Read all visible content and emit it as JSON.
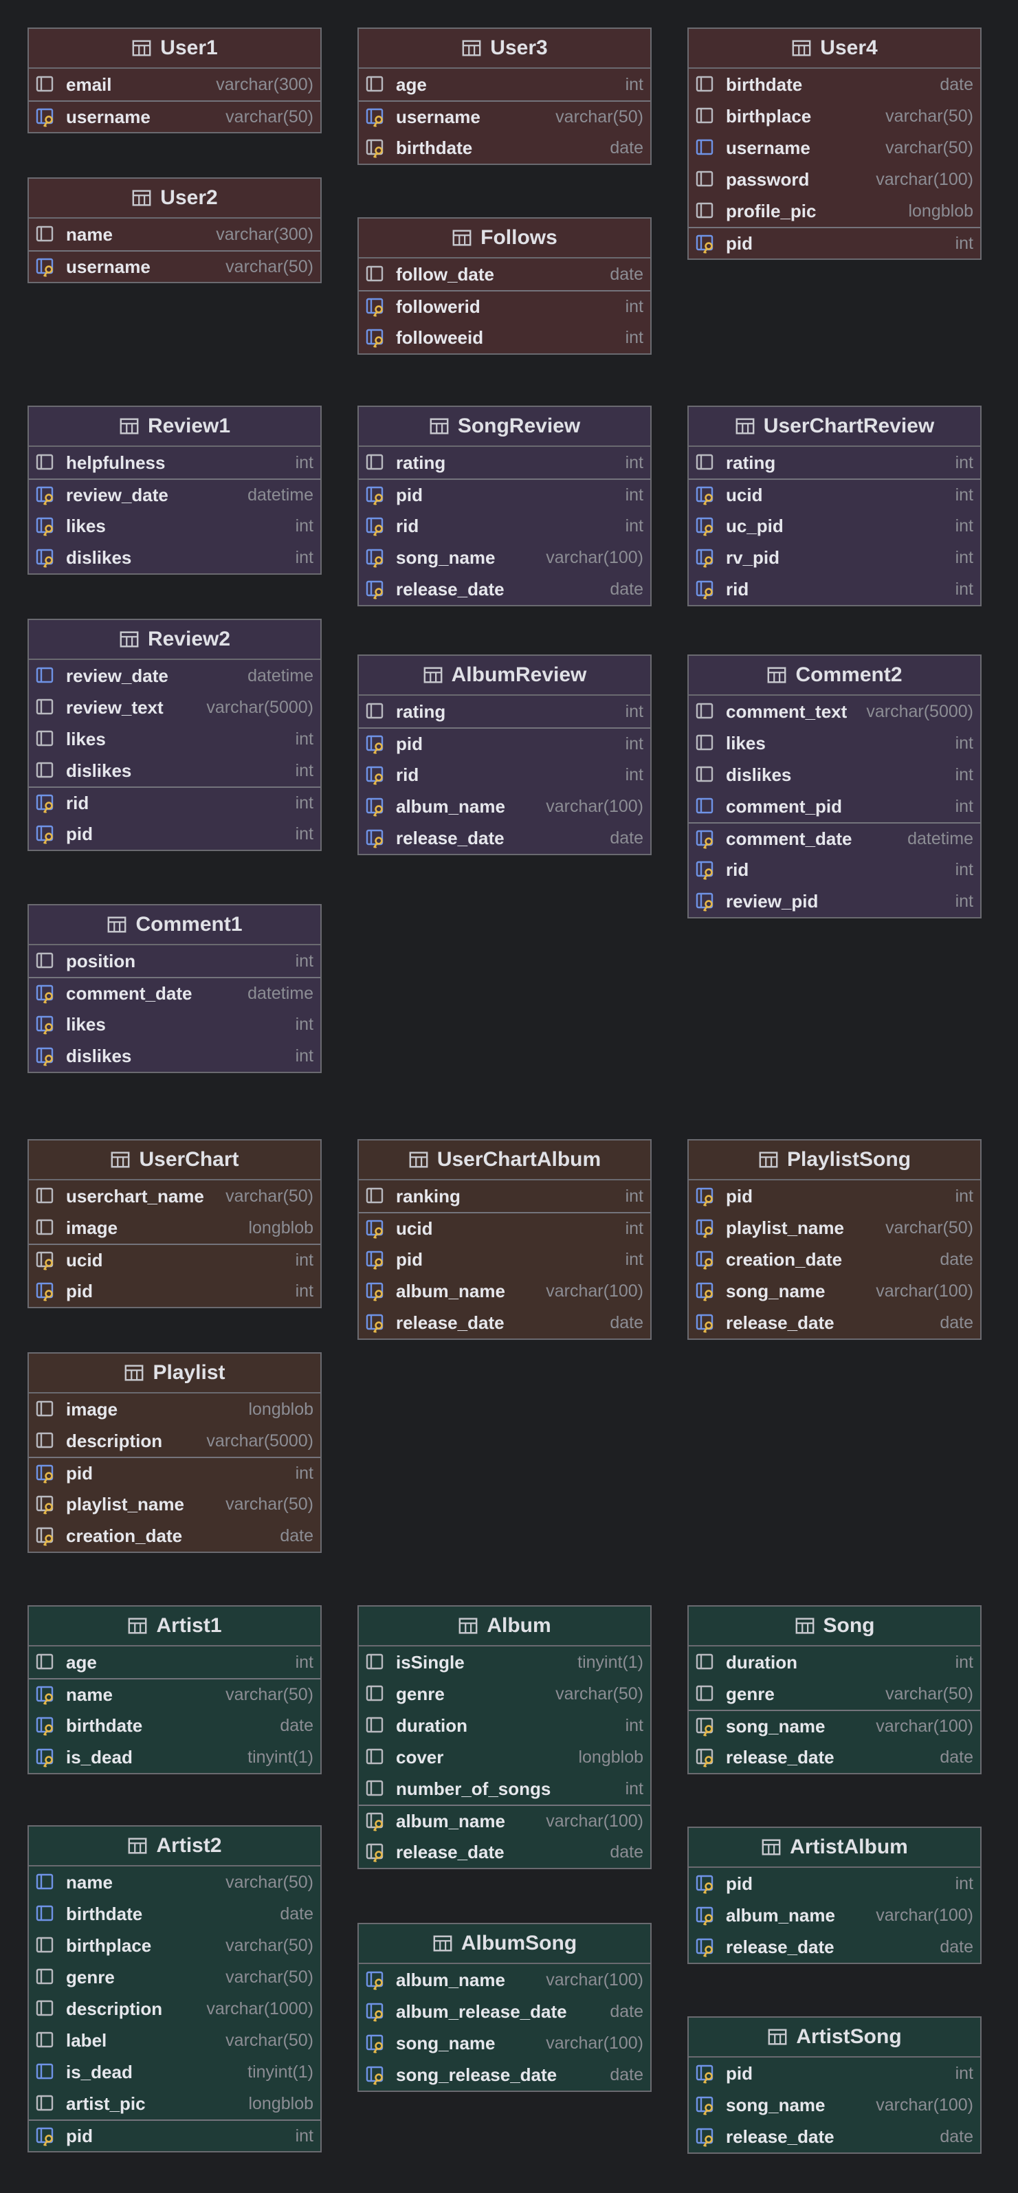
{
  "tables": [
    {
      "name": "User1",
      "group": "user",
      "columns": [
        {
          "name": "email",
          "type": "varchar(300)",
          "icon": "column-icon"
        },
        {
          "name": "username",
          "type": "varchar(50)",
          "icon": "primary-foreign-key-icon",
          "sep": true
        }
      ]
    },
    {
      "name": "User2",
      "group": "user",
      "columns": [
        {
          "name": "name",
          "type": "varchar(300)",
          "icon": "column-icon"
        },
        {
          "name": "username",
          "type": "varchar(50)",
          "icon": "primary-foreign-key-icon",
          "sep": true
        }
      ]
    },
    {
      "name": "User3",
      "group": "user",
      "columns": [
        {
          "name": "age",
          "type": "int",
          "icon": "column-icon"
        },
        {
          "name": "username",
          "type": "varchar(50)",
          "icon": "primary-foreign-key-icon",
          "sep": true
        },
        {
          "name": "birthdate",
          "type": "date",
          "icon": "primary-key-icon"
        }
      ]
    },
    {
      "name": "Follows",
      "group": "user",
      "columns": [
        {
          "name": "follow_date",
          "type": "date",
          "icon": "column-icon"
        },
        {
          "name": "followerid",
          "type": "int",
          "icon": "primary-foreign-key-icon",
          "sep": true
        },
        {
          "name": "followeeid",
          "type": "int",
          "icon": "primary-foreign-key-icon"
        }
      ]
    },
    {
      "name": "User4",
      "group": "user",
      "columns": [
        {
          "name": "birthdate",
          "type": "date",
          "icon": "column-icon"
        },
        {
          "name": "birthplace",
          "type": "varchar(50)",
          "icon": "column-icon"
        },
        {
          "name": "username",
          "type": "varchar(50)",
          "icon": "foreign-key-icon"
        },
        {
          "name": "password",
          "type": "varchar(100)",
          "icon": "column-icon"
        },
        {
          "name": "profile_pic",
          "type": "longblob",
          "icon": "column-icon"
        },
        {
          "name": "pid",
          "type": "int",
          "icon": "primary-foreign-key-icon",
          "sep": true
        }
      ]
    },
    {
      "name": "Review1",
      "group": "review",
      "columns": [
        {
          "name": "helpfulness",
          "type": "int",
          "icon": "column-icon"
        },
        {
          "name": "review_date",
          "type": "datetime",
          "icon": "primary-foreign-key-icon",
          "sep": true
        },
        {
          "name": "likes",
          "type": "int",
          "icon": "primary-foreign-key-icon"
        },
        {
          "name": "dislikes",
          "type": "int",
          "icon": "primary-foreign-key-icon"
        }
      ]
    },
    {
      "name": "Review2",
      "group": "review",
      "columns": [
        {
          "name": "review_date",
          "type": "datetime",
          "icon": "foreign-key-icon"
        },
        {
          "name": "review_text",
          "type": "varchar(5000)",
          "icon": "column-icon"
        },
        {
          "name": "likes",
          "type": "int",
          "icon": "column-icon"
        },
        {
          "name": "dislikes",
          "type": "int",
          "icon": "column-icon"
        },
        {
          "name": "rid",
          "type": "int",
          "icon": "primary-foreign-key-icon",
          "sep": true
        },
        {
          "name": "pid",
          "type": "int",
          "icon": "primary-foreign-key-icon"
        }
      ]
    },
    {
      "name": "Comment1",
      "group": "review",
      "columns": [
        {
          "name": "position",
          "type": "int",
          "icon": "column-icon"
        },
        {
          "name": "comment_date",
          "type": "datetime",
          "icon": "primary-foreign-key-icon",
          "sep": true
        },
        {
          "name": "likes",
          "type": "int",
          "icon": "primary-foreign-key-icon"
        },
        {
          "name": "dislikes",
          "type": "int",
          "icon": "primary-foreign-key-icon"
        }
      ]
    },
    {
      "name": "SongReview",
      "group": "review",
      "columns": [
        {
          "name": "rating",
          "type": "int",
          "icon": "column-icon"
        },
        {
          "name": "pid",
          "type": "int",
          "icon": "primary-foreign-key-icon",
          "sep": true
        },
        {
          "name": "rid",
          "type": "int",
          "icon": "primary-foreign-key-icon"
        },
        {
          "name": "song_name",
          "type": "varchar(100)",
          "icon": "primary-foreign-key-icon"
        },
        {
          "name": "release_date",
          "type": "date",
          "icon": "primary-foreign-key-icon"
        }
      ]
    },
    {
      "name": "AlbumReview",
      "group": "review",
      "columns": [
        {
          "name": "rating",
          "type": "int",
          "icon": "column-icon"
        },
        {
          "name": "pid",
          "type": "int",
          "icon": "primary-foreign-key-icon",
          "sep": true
        },
        {
          "name": "rid",
          "type": "int",
          "icon": "primary-foreign-key-icon"
        },
        {
          "name": "album_name",
          "type": "varchar(100)",
          "icon": "primary-foreign-key-icon"
        },
        {
          "name": "release_date",
          "type": "date",
          "icon": "primary-foreign-key-icon"
        }
      ]
    },
    {
      "name": "UserChartReview",
      "group": "review",
      "columns": [
        {
          "name": "rating",
          "type": "int",
          "icon": "column-icon"
        },
        {
          "name": "ucid",
          "type": "int",
          "icon": "primary-foreign-key-icon",
          "sep": true
        },
        {
          "name": "uc_pid",
          "type": "int",
          "icon": "primary-foreign-key-icon"
        },
        {
          "name": "rv_pid",
          "type": "int",
          "icon": "primary-foreign-key-icon"
        },
        {
          "name": "rid",
          "type": "int",
          "icon": "primary-foreign-key-icon"
        }
      ]
    },
    {
      "name": "Comment2",
      "group": "review",
      "columns": [
        {
          "name": "comment_text",
          "type": "varchar(5000)",
          "icon": "column-icon"
        },
        {
          "name": "likes",
          "type": "int",
          "icon": "column-icon"
        },
        {
          "name": "dislikes",
          "type": "int",
          "icon": "column-icon"
        },
        {
          "name": "comment_pid",
          "type": "int",
          "icon": "foreign-key-icon"
        },
        {
          "name": "comment_date",
          "type": "datetime",
          "icon": "primary-foreign-key-icon",
          "sep": true
        },
        {
          "name": "rid",
          "type": "int",
          "icon": "primary-foreign-key-icon"
        },
        {
          "name": "review_pid",
          "type": "int",
          "icon": "primary-foreign-key-icon"
        }
      ]
    },
    {
      "name": "UserChart",
      "group": "chart",
      "columns": [
        {
          "name": "userchart_name",
          "type": "varchar(50)",
          "icon": "column-icon"
        },
        {
          "name": "image",
          "type": "longblob",
          "icon": "column-icon"
        },
        {
          "name": "ucid",
          "type": "int",
          "icon": "primary-key-icon",
          "sep": true
        },
        {
          "name": "pid",
          "type": "int",
          "icon": "primary-foreign-key-icon"
        }
      ]
    },
    {
      "name": "Playlist",
      "group": "chart",
      "columns": [
        {
          "name": "image",
          "type": "longblob",
          "icon": "column-icon"
        },
        {
          "name": "description",
          "type": "varchar(5000)",
          "icon": "column-icon"
        },
        {
          "name": "pid",
          "type": "int",
          "icon": "primary-foreign-key-icon",
          "sep": true
        },
        {
          "name": "playlist_name",
          "type": "varchar(50)",
          "icon": "primary-key-icon"
        },
        {
          "name": "creation_date",
          "type": "date",
          "icon": "primary-key-icon"
        }
      ]
    },
    {
      "name": "UserChartAlbum",
      "group": "chart",
      "columns": [
        {
          "name": "ranking",
          "type": "int",
          "icon": "column-icon"
        },
        {
          "name": "ucid",
          "type": "int",
          "icon": "primary-foreign-key-icon",
          "sep": true
        },
        {
          "name": "pid",
          "type": "int",
          "icon": "primary-foreign-key-icon"
        },
        {
          "name": "album_name",
          "type": "varchar(100)",
          "icon": "primary-foreign-key-icon"
        },
        {
          "name": "release_date",
          "type": "date",
          "icon": "primary-foreign-key-icon"
        }
      ]
    },
    {
      "name": "PlaylistSong",
      "group": "chart",
      "columns": [
        {
          "name": "pid",
          "type": "int",
          "icon": "primary-foreign-key-icon"
        },
        {
          "name": "playlist_name",
          "type": "varchar(50)",
          "icon": "primary-foreign-key-icon"
        },
        {
          "name": "creation_date",
          "type": "date",
          "icon": "primary-foreign-key-icon"
        },
        {
          "name": "song_name",
          "type": "varchar(100)",
          "icon": "primary-foreign-key-icon"
        },
        {
          "name": "release_date",
          "type": "date",
          "icon": "primary-foreign-key-icon"
        }
      ]
    },
    {
      "name": "Artist1",
      "group": "music",
      "columns": [
        {
          "name": "age",
          "type": "int",
          "icon": "column-icon"
        },
        {
          "name": "name",
          "type": "varchar(50)",
          "icon": "primary-foreign-key-icon",
          "sep": true
        },
        {
          "name": "birthdate",
          "type": "date",
          "icon": "primary-foreign-key-icon"
        },
        {
          "name": "is_dead",
          "type": "tinyint(1)",
          "icon": "primary-foreign-key-icon"
        }
      ]
    },
    {
      "name": "Artist2",
      "group": "music",
      "columns": [
        {
          "name": "name",
          "type": "varchar(50)",
          "icon": "foreign-key-icon"
        },
        {
          "name": "birthdate",
          "type": "date",
          "icon": "foreign-key-icon"
        },
        {
          "name": "birthplace",
          "type": "varchar(50)",
          "icon": "column-icon"
        },
        {
          "name": "genre",
          "type": "varchar(50)",
          "icon": "column-icon"
        },
        {
          "name": "description",
          "type": "varchar(1000)",
          "icon": "column-icon"
        },
        {
          "name": "label",
          "type": "varchar(50)",
          "icon": "column-icon"
        },
        {
          "name": "is_dead",
          "type": "tinyint(1)",
          "icon": "foreign-key-icon"
        },
        {
          "name": "artist_pic",
          "type": "longblob",
          "icon": "column-icon"
        },
        {
          "name": "pid",
          "type": "int",
          "icon": "primary-foreign-key-icon",
          "sep": true
        }
      ]
    },
    {
      "name": "Album",
      "group": "music",
      "columns": [
        {
          "name": "isSingle",
          "type": "tinyint(1)",
          "icon": "column-icon"
        },
        {
          "name": "genre",
          "type": "varchar(50)",
          "icon": "column-icon"
        },
        {
          "name": "duration",
          "type": "int",
          "icon": "column-icon"
        },
        {
          "name": "cover",
          "type": "longblob",
          "icon": "column-icon"
        },
        {
          "name": "number_of_songs",
          "type": "int",
          "icon": "column-icon"
        },
        {
          "name": "album_name",
          "type": "varchar(100)",
          "icon": "primary-key-icon",
          "sep": true
        },
        {
          "name": "release_date",
          "type": "date",
          "icon": "primary-key-icon"
        }
      ]
    },
    {
      "name": "AlbumSong",
      "group": "music",
      "columns": [
        {
          "name": "album_name",
          "type": "varchar(100)",
          "icon": "primary-foreign-key-icon"
        },
        {
          "name": "album_release_date",
          "type": "date",
          "icon": "primary-foreign-key-icon"
        },
        {
          "name": "song_name",
          "type": "varchar(100)",
          "icon": "primary-foreign-key-icon"
        },
        {
          "name": "song_release_date",
          "type": "date",
          "icon": "primary-foreign-key-icon"
        }
      ]
    },
    {
      "name": "Song",
      "group": "music",
      "columns": [
        {
          "name": "duration",
          "type": "int",
          "icon": "column-icon"
        },
        {
          "name": "genre",
          "type": "varchar(50)",
          "icon": "column-icon"
        },
        {
          "name": "song_name",
          "type": "varchar(100)",
          "icon": "primary-key-icon",
          "sep": true
        },
        {
          "name": "release_date",
          "type": "date",
          "icon": "primary-key-icon"
        }
      ]
    },
    {
      "name": "ArtistAlbum",
      "group": "music",
      "columns": [
        {
          "name": "pid",
          "type": "int",
          "icon": "primary-foreign-key-icon"
        },
        {
          "name": "album_name",
          "type": "varchar(100)",
          "icon": "primary-foreign-key-icon"
        },
        {
          "name": "release_date",
          "type": "date",
          "icon": "primary-foreign-key-icon"
        }
      ]
    },
    {
      "name": "ArtistSong",
      "group": "music",
      "columns": [
        {
          "name": "pid",
          "type": "int",
          "icon": "primary-foreign-key-icon"
        },
        {
          "name": "song_name",
          "type": "varchar(100)",
          "icon": "primary-foreign-key-icon"
        },
        {
          "name": "release_date",
          "type": "date",
          "icon": "primary-foreign-key-icon"
        }
      ]
    }
  ]
}
